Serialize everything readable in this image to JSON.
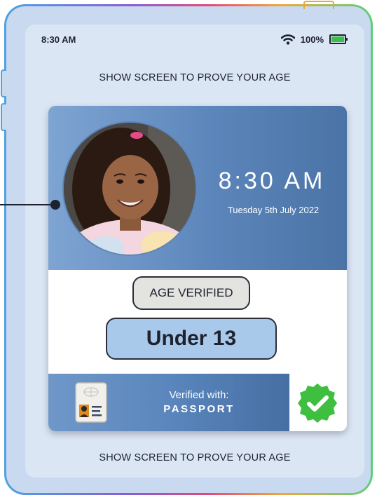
{
  "status_bar": {
    "time": "8:30 AM",
    "battery_percent": "100%",
    "battery_level": 1.0
  },
  "banner": {
    "top_text": "SHOW SCREEN TO PROVE YOUR AGE",
    "bottom_text": "SHOW SCREEN TO PROVE YOUR AGE"
  },
  "card": {
    "time": "8:30 AM",
    "date": "Tuesday 5th July 2022",
    "verified_badge": "AGE VERIFIED",
    "age_group": "Under 13",
    "verified_with_label": "Verified with:",
    "document_type": "PASSPORT"
  },
  "colors": {
    "card_header": "#5c86bb",
    "age_pill": "#a9c9ea",
    "check_green": "#3fbf3f",
    "battery_green": "#39c04a"
  },
  "icons": [
    "wifi-icon",
    "battery-icon",
    "passport-icon",
    "verified-check-icon"
  ]
}
